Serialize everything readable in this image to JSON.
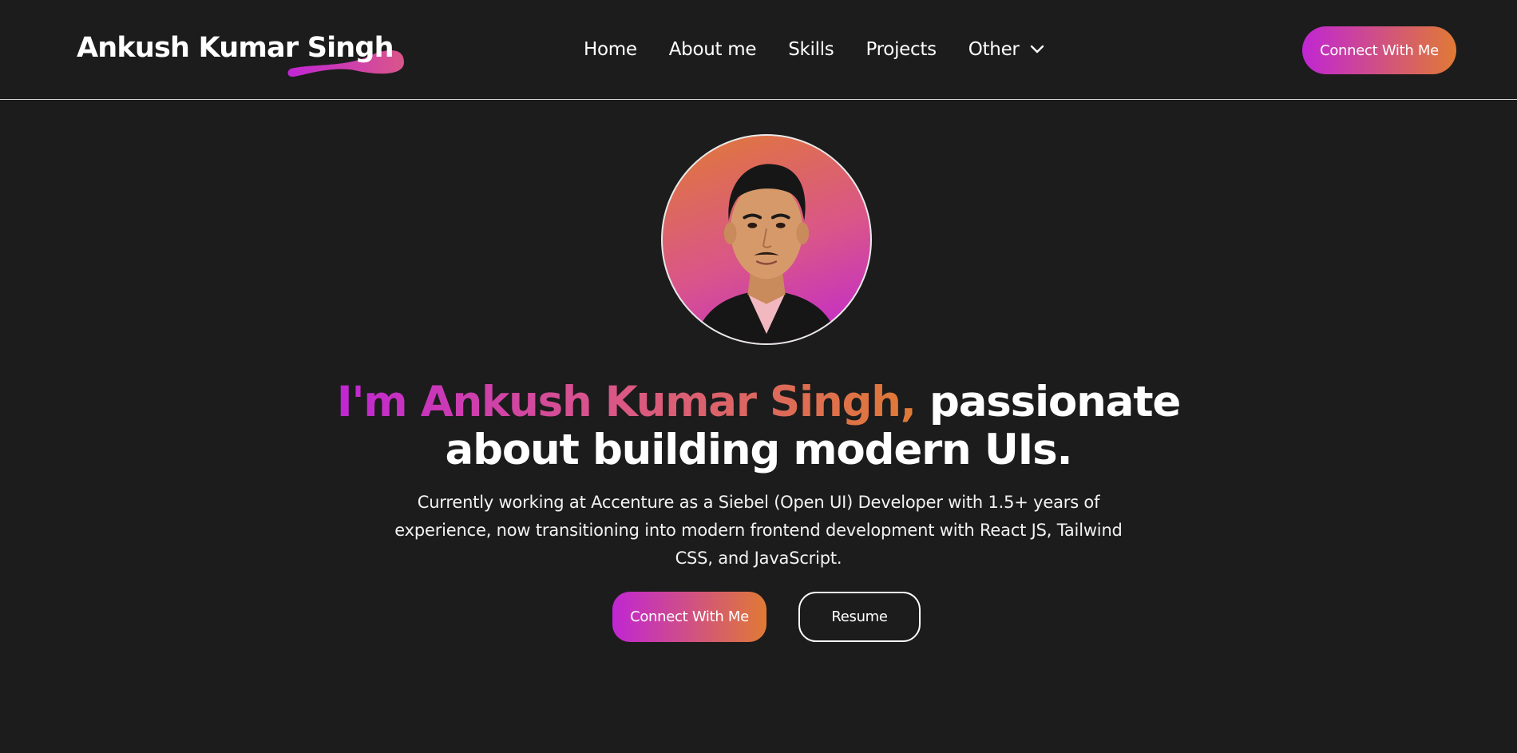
{
  "header": {
    "logo_text": "Ankush Kumar Singh",
    "nav": [
      {
        "label": "Home"
      },
      {
        "label": "About me"
      },
      {
        "label": "Skills"
      },
      {
        "label": "Projects"
      },
      {
        "label": "Other",
        "icon": "chevron-down-icon"
      }
    ],
    "cta_label": "Connect With Me"
  },
  "hero": {
    "heading_name": "I'm Ankush Kumar Singh,",
    "heading_rest": "passionate about building modern UIs.",
    "subtitle": "Currently working at Accenture as a Siebel (Open UI) Developer with 1.5+ years of experience, now transitioning into modern frontend development with React JS, Tailwind CSS, and JavaScript.",
    "primary_cta": "Connect With Me",
    "secondary_cta": "Resume"
  },
  "colors": {
    "background": "#1c1c1c",
    "gradient_start": "#c026d3",
    "gradient_end": "#e07a35",
    "text": "#ffffff"
  }
}
